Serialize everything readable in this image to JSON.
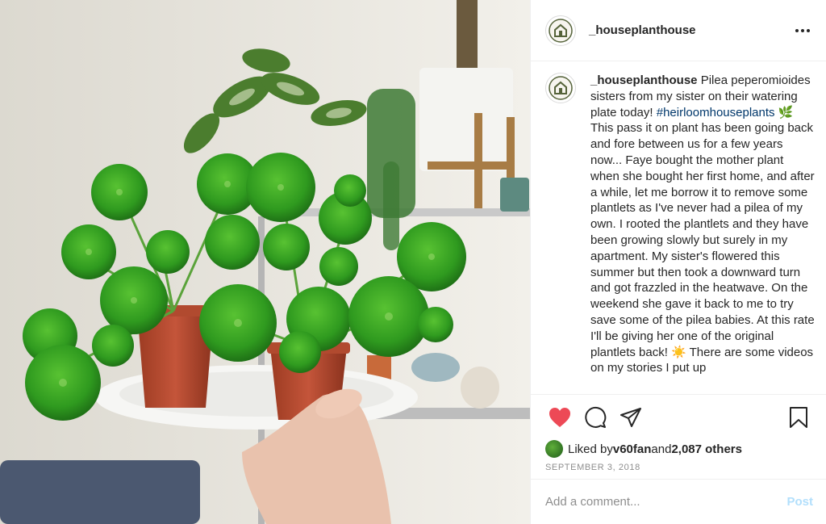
{
  "post": {
    "username": "_houseplanthouse",
    "more_icon": "more-horizontal-icon",
    "caption": {
      "username": "_houseplanthouse",
      "text_before_tag": " Pilea peperomioides sisters from my sister on their watering plate today! ",
      "hashtag": "#heirloomhouseplants",
      "emoji_leaf": "🌿",
      "text_middle": " This pass it on plant has been going back and fore between us for a few years now... Faye bought the mother plant when she bought her first home, and after a while, let me borrow it to remove some plantlets as I've never had a pilea of my own. I rooted the plantlets and they have been growing slowly but surely in my apartment. My sister's flowered this summer but then took a downward turn and got frazzled in the heatwave. On the weekend she gave it back to me to try save some of the pilea babies. At this rate I'll be giving her one of the original plantlets back! ",
      "emoji_sun": "☀️",
      "text_after": " There are some videos on my stories I put up"
    },
    "likes": {
      "prefix": "Liked by ",
      "user": "v60fan",
      "middle": " and ",
      "others": "2,087 others"
    },
    "date": "SEPTEMBER 3, 2018",
    "comment": {
      "placeholder": "Add a comment...",
      "post_label": "Post"
    }
  },
  "colors": {
    "like_red": "#ed4956",
    "link_blue": "#00376b",
    "post_disabled": "#b2dffc",
    "muted": "#8e8e8e"
  },
  "icons": [
    "heart-icon",
    "comment-icon",
    "share-icon",
    "bookmark-icon",
    "more-horizontal-icon",
    "house-logo-icon"
  ]
}
